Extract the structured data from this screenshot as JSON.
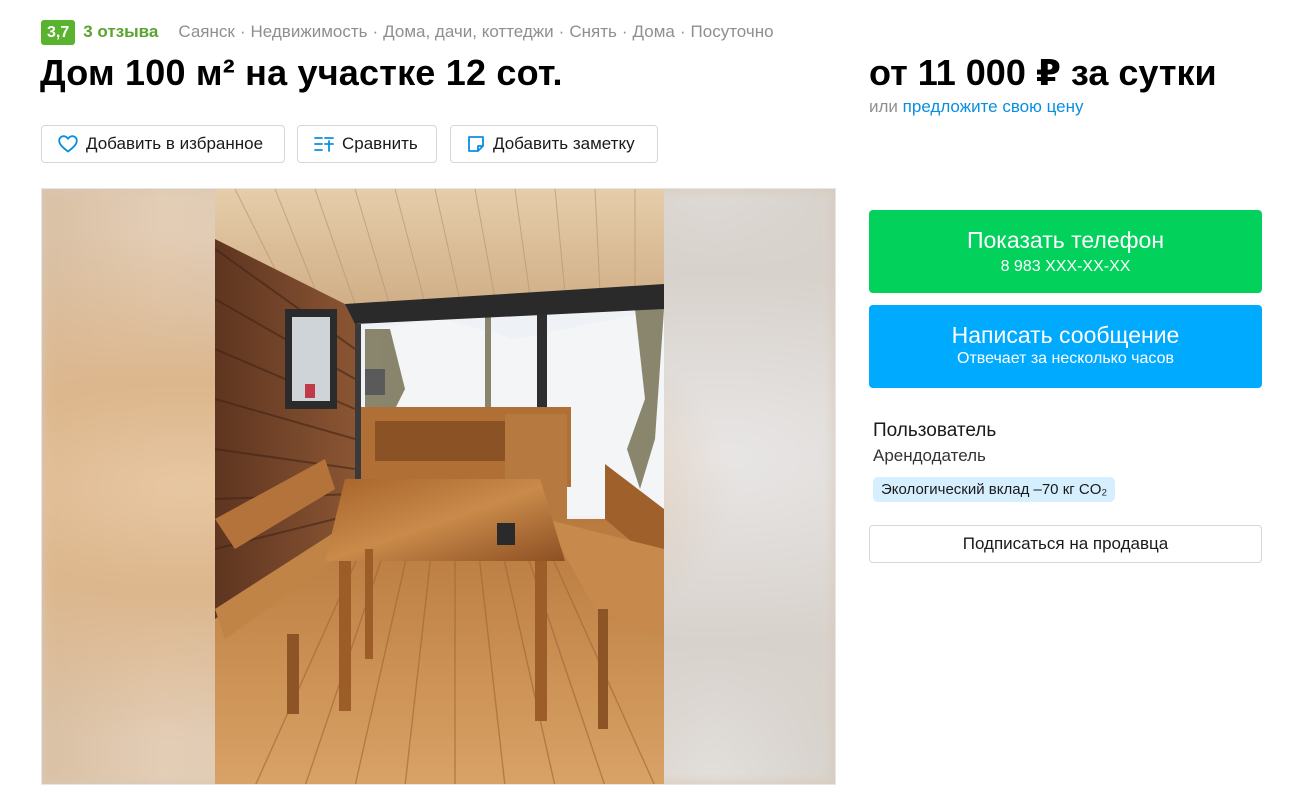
{
  "header": {
    "rating": "3,7",
    "reviews": "3 отзыва",
    "breadcrumbs": [
      "Саянск",
      "Недвижимость",
      "Дома, дачи, коттеджи",
      "Снять",
      "Дома",
      "Посуточно"
    ],
    "breadcrumb_separator": "·"
  },
  "listing": {
    "title": "Дом 100 м² на участке 12 сот.",
    "price": "от 11 000 ₽ за сутки",
    "offer_prefix": "или",
    "offer_link": "предложите свою цену"
  },
  "actions": {
    "favorite": "Добавить в избранное",
    "compare": "Сравнить",
    "note": "Добавить заметку"
  },
  "contact": {
    "phone_title": "Показать телефон",
    "phone_masked": "8 983 XXX-XX-XX",
    "message_title": "Написать сообщение",
    "message_subtitle": "Отвечает за несколько часов"
  },
  "seller": {
    "name": "Пользователь",
    "role": "Арендодатель",
    "eco_badge": "Экологический вклад –70 кг CO₂",
    "subscribe": "Подписаться на продавца"
  },
  "icons": {
    "favorite": "heart-outline-icon",
    "compare": "compare-list-icon",
    "note": "sticky-note-icon"
  },
  "colors": {
    "accent_green": "#02d15c",
    "accent_blue": "#00aaff",
    "rating_green": "#59b32e",
    "link_blue": "#0a8fe0",
    "eco_badge_bg": "#d6efff"
  }
}
